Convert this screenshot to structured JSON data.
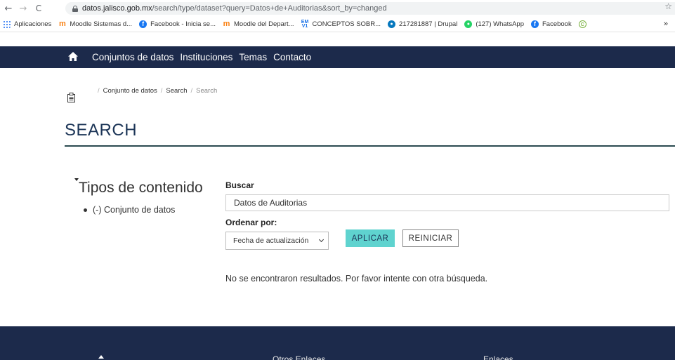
{
  "browser": {
    "url_host": "datos.jalisco.gob.mx",
    "url_path": "/search/type/dataset?query=Datos+de+Auditorias&sort_by=changed",
    "bookmarks": [
      {
        "label": "Aplicaciones",
        "icon": "apps-grid-icon"
      },
      {
        "label": "Moodle Sistemas d...",
        "icon": "moodle-icon"
      },
      {
        "label": "Facebook - Inicia se...",
        "icon": "facebook-icon"
      },
      {
        "label": "Moodle del Depart...",
        "icon": "moodle-icon"
      },
      {
        "label": "CONCEPTOS SOBR...",
        "icon": "em-icon"
      },
      {
        "label": "217281887 | Drupal",
        "icon": "drupal-icon"
      },
      {
        "label": "(127) WhatsApp",
        "icon": "whatsapp-icon"
      },
      {
        "label": "Facebook",
        "icon": "facebook-icon"
      },
      {
        "label": "",
        "icon": "copyright-icon"
      }
    ],
    "more": "»"
  },
  "nav": {
    "links": [
      "Conjuntos de datos",
      "Instituciones",
      "Temas",
      "Contacto"
    ]
  },
  "breadcrumb": [
    "Conjunto de datos",
    "Search",
    "Search"
  ],
  "page_title": "SEARCH",
  "facets": {
    "title": "Tipos de contenido",
    "items": [
      "(-) Conjunto de datos"
    ]
  },
  "form": {
    "search_label": "Buscar",
    "search_value": "Datos de Auditorias",
    "sort_label": "Ordenar por:",
    "sort_selected": "Fecha de actualización",
    "apply_label": "APLICAR",
    "reset_label": "REINICIAR"
  },
  "results": {
    "message": "No se encontraron resultados. Por favor intente con otra búsqueda."
  },
  "footer": {
    "col1": "Otros Enlaces",
    "col2": "Enlaces"
  },
  "colors": {
    "nav_bg": "#1c2a4b",
    "accent": "#5fd3cf",
    "title": "#1c3557"
  }
}
